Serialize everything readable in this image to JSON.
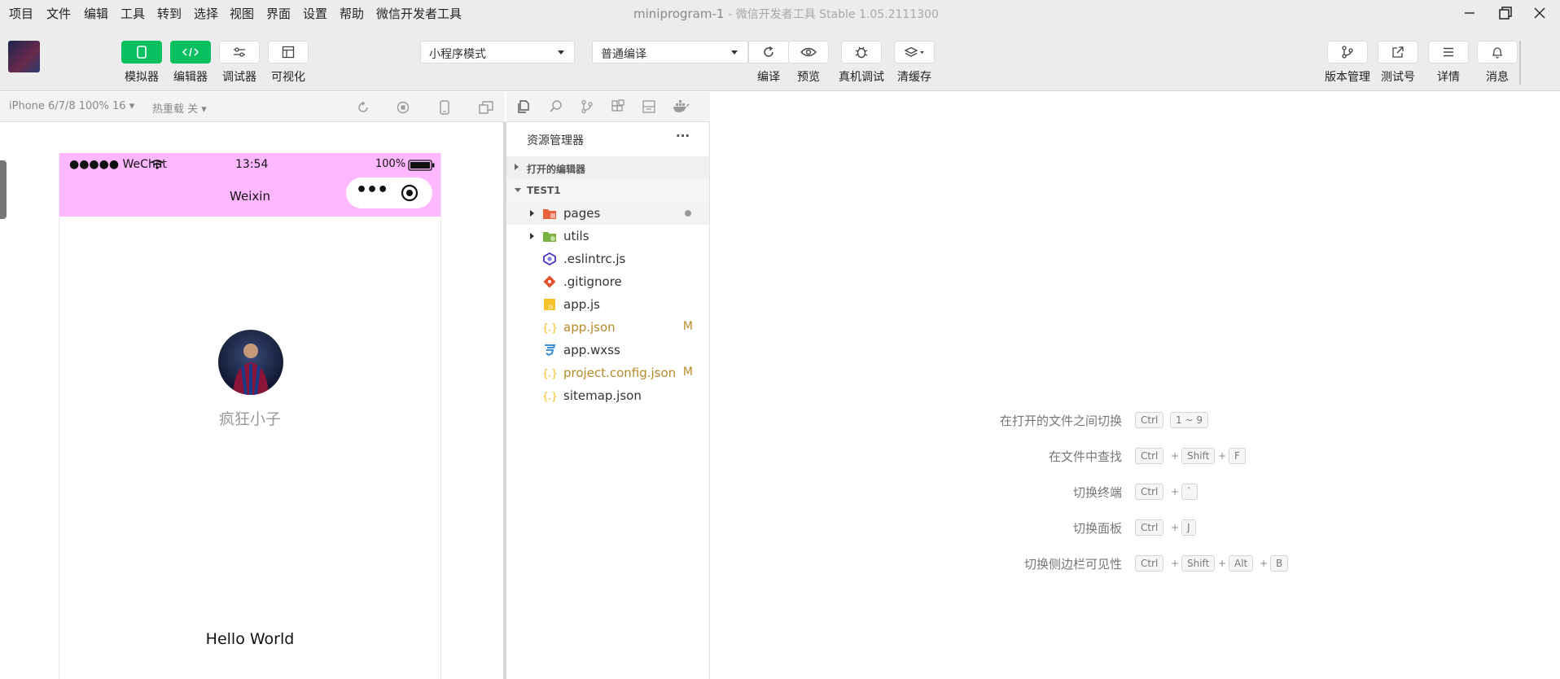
{
  "menu": [
    "项目",
    "文件",
    "编辑",
    "工具",
    "转到",
    "选择",
    "视图",
    "界面",
    "设置",
    "帮助",
    "微信开发者工具"
  ],
  "window": {
    "title": "miniprogram-1",
    "subtitle": "- 微信开发者工具 Stable 1.05.2111300"
  },
  "toolbar": {
    "simulator": "模拟器",
    "editor": "编辑器",
    "debugger": "调试器",
    "visualize": "可视化",
    "mode_select": "小程序模式",
    "compile_select": "普通编译",
    "compile": "编译",
    "preview": "预览",
    "real_debug": "真机调试",
    "clear_cache": "清缓存",
    "version": "版本管理",
    "test_account": "测试号",
    "details": "详情",
    "messages": "消息"
  },
  "simbar": {
    "device": "iPhone 6/7/8 100% 16 ▾",
    "hot_reload": "热重载 关 ▾"
  },
  "phone": {
    "status_left": "●●●●● WeChat",
    "time": "13:54",
    "battery": "100%",
    "nav_title": "Weixin",
    "capsule_dots": "•••",
    "nickname": "疯狂小子",
    "hello": "Hello World"
  },
  "explorer": {
    "title": "资源管理器",
    "more": "···",
    "open_editors": "打开的编辑器",
    "project": "TEST1",
    "files": [
      {
        "name": "pages",
        "badge": ""
      },
      {
        "name": "utils",
        "badge": ""
      },
      {
        "name": ".eslintrc.js",
        "badge": ""
      },
      {
        "name": ".gitignore",
        "badge": ""
      },
      {
        "name": "app.js",
        "badge": ""
      },
      {
        "name": "app.json",
        "badge": "M"
      },
      {
        "name": "app.wxss",
        "badge": ""
      },
      {
        "name": "project.config.json",
        "badge": "M"
      },
      {
        "name": "sitemap.json",
        "badge": ""
      }
    ]
  },
  "shortcuts": [
    {
      "label": "在打开的文件之间切换",
      "keys": [
        "Ctrl",
        "1 ~ 9"
      ]
    },
    {
      "label": "在文件中查找",
      "keys": [
        "Ctrl",
        "+",
        "Shift",
        "+",
        "F"
      ]
    },
    {
      "label": "切换终端",
      "keys": [
        "Ctrl",
        "+",
        "`"
      ]
    },
    {
      "label": "切换面板",
      "keys": [
        "Ctrl",
        "+",
        "J"
      ]
    },
    {
      "label": "切换侧边栏可见性",
      "keys": [
        "Ctrl",
        "+",
        "Shift",
        "+",
        "Alt",
        "+",
        "B"
      ]
    }
  ],
  "colors": {
    "accent": "#07c160",
    "nav_bg": "#ffb8ff",
    "modified": "#b58a2a"
  }
}
